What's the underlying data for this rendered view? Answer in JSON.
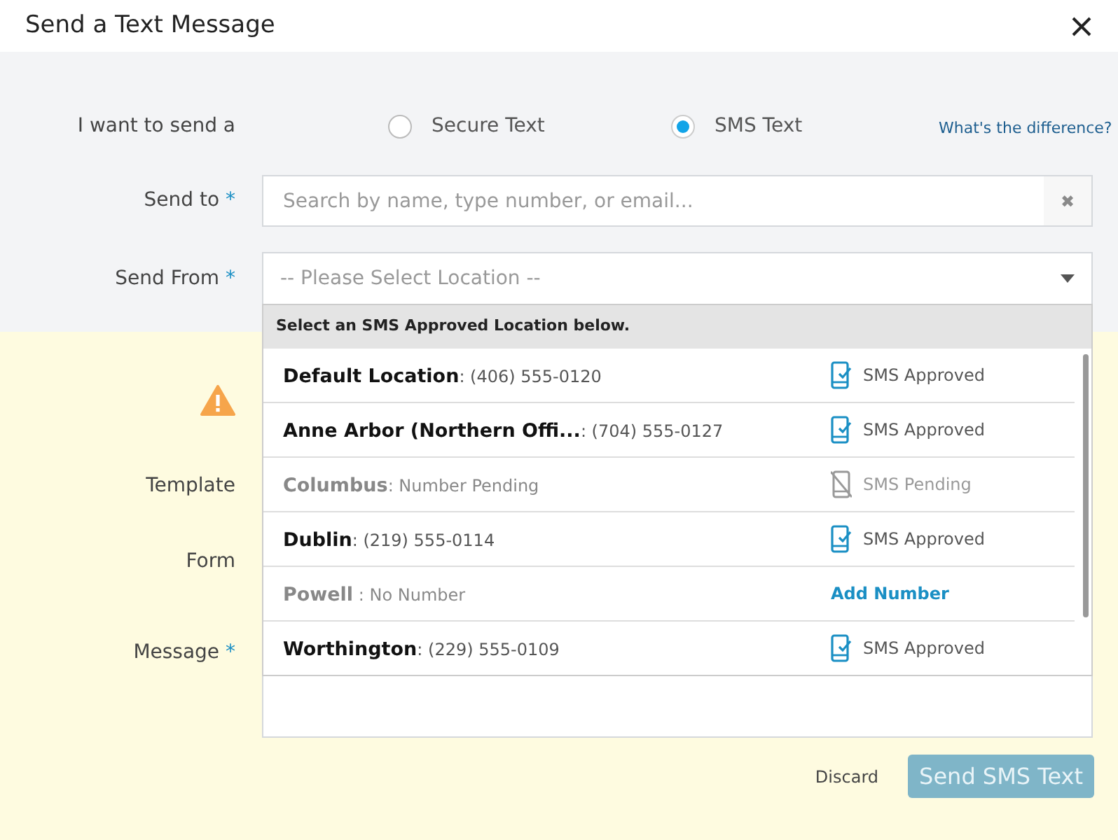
{
  "window": {
    "title": "Send a Text Message"
  },
  "send_type": {
    "label": "I want to send a",
    "options": [
      {
        "label": "Secure Text",
        "selected": false
      },
      {
        "label": "SMS Text",
        "selected": true
      }
    ],
    "help_link": "What's the difference?"
  },
  "send_to": {
    "label": "Send to",
    "required_mark": "*",
    "placeholder": "Search by name, type number, or email...",
    "clear": "✖"
  },
  "send_from": {
    "label": "Send From",
    "required_mark": "*",
    "placeholder": "-- Please Select Location --",
    "dropdown": {
      "expanded": true,
      "header": "Select an SMS Approved Location below.",
      "items": [
        {
          "name": "Default Location",
          "separator": ": ",
          "detail": "(406) 555-0120",
          "kind": "approved",
          "status": "SMS Approved",
          "disabled": false
        },
        {
          "name": "Anne Arbor (Northern Offi...",
          "separator": ": ",
          "detail": "(704) 555-0127",
          "kind": "approved",
          "status": "SMS Approved",
          "disabled": false
        },
        {
          "name": "Columbus",
          "separator": ": ",
          "detail": "Number Pending",
          "kind": "pending",
          "status": "SMS Pending",
          "disabled": true
        },
        {
          "name": "Dublin",
          "separator": ": ",
          "detail": "(219) 555-0114",
          "kind": "approved",
          "status": "SMS Approved",
          "disabled": false
        },
        {
          "name": "Powell",
          "separator": " : ",
          "detail": "No Number",
          "kind": "add",
          "status": "Add Number",
          "disabled": true
        },
        {
          "name": "Worthington",
          "separator": ": ",
          "detail": "(229) 555-0109",
          "kind": "approved",
          "status": "SMS Approved",
          "disabled": false
        }
      ]
    }
  },
  "labels": [
    {
      "kind": "warning"
    },
    {
      "kind": "text",
      "text": "Template"
    },
    {
      "kind": "text",
      "text": "Form"
    },
    {
      "kind": "required",
      "text": "Message",
      "required_mark": "*"
    }
  ],
  "buttons": [
    {
      "kind": "link",
      "label": "Discard"
    },
    {
      "kind": "primary",
      "label": "Send SMS Text",
      "disabled": true
    }
  ]
}
